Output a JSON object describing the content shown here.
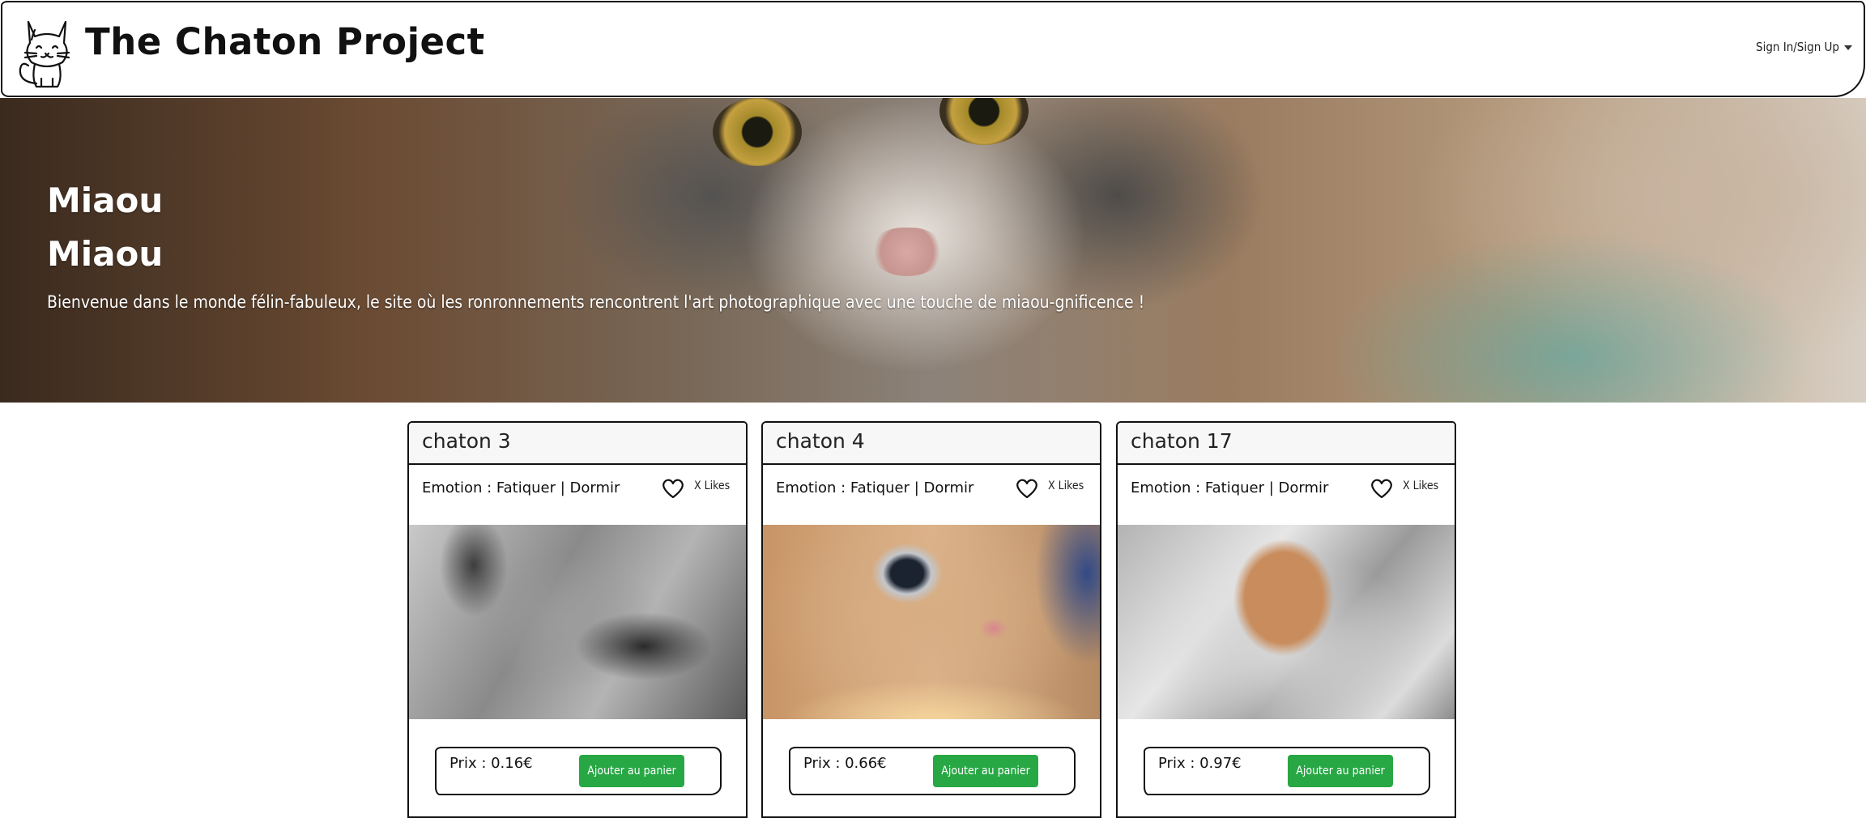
{
  "navbar": {
    "brand_title": "The Chaton Project",
    "logo_icon": "cat-logo-icon",
    "auth_menu_label": "Sign In/Sign Up"
  },
  "hero": {
    "title_line1": "Miaou",
    "title_line2": "Miaou",
    "subtitle": "Bienvenue dans le monde félin-fabuleux, le site où les ronronnements rencontrent l'art photographique avec une touche de miaou-gnificence !"
  },
  "cards": [
    {
      "name": "chaton 3",
      "emotion": "Emotion : Fatiquer | Dormir",
      "likes": "X Likes",
      "price": "Prix : 0.16€",
      "button": "Ajouter au panier"
    },
    {
      "name": "chaton 4",
      "emotion": "Emotion : Fatiquer | Dormir",
      "likes": "X Likes",
      "price": "Prix : 0.66€",
      "button": "Ajouter au panier"
    },
    {
      "name": "chaton 17",
      "emotion": "Emotion : Fatiquer | Dormir",
      "likes": "X Likes",
      "price": "Prix : 0.97€",
      "button": "Ajouter au panier"
    }
  ],
  "colors": {
    "accent_button": "#28a745",
    "border": "#111111",
    "card_header_bg": "#f7f7f7"
  }
}
